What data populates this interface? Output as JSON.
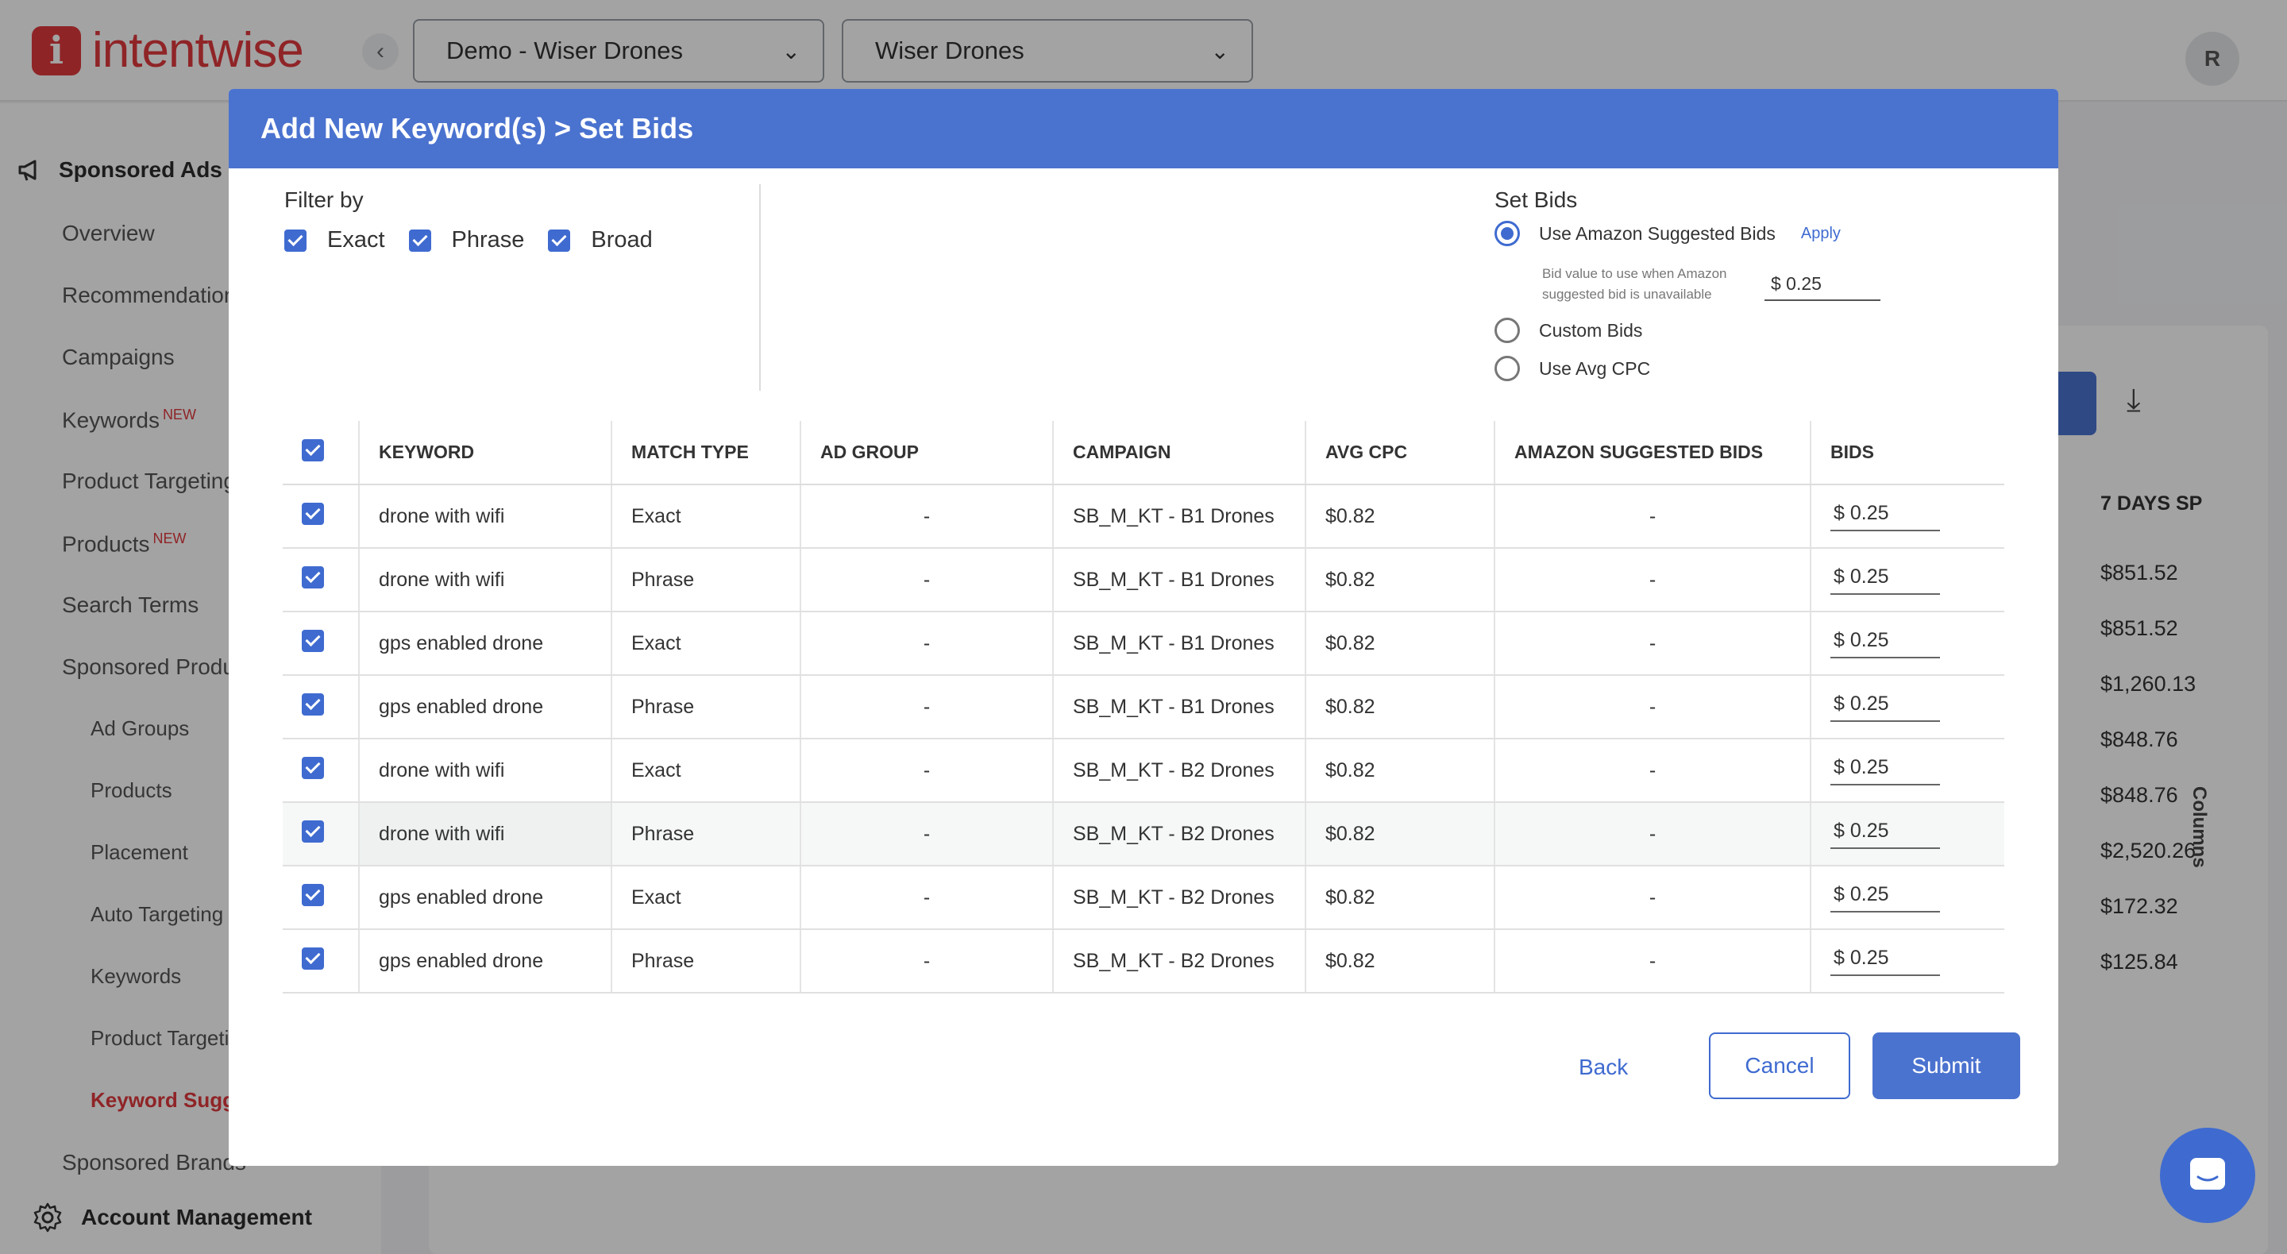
{
  "app": {
    "logo_text": "intentwise",
    "logo_mark": "i",
    "account_select": "Demo - Wiser Drones",
    "profile_select": "Wiser Drones",
    "avatar_initial": "R"
  },
  "sidebar": {
    "section": "Sponsored Ads",
    "items": [
      {
        "label": "Overview",
        "badge": ""
      },
      {
        "label": "Recommendations",
        "badge": ""
      },
      {
        "label": "Campaigns",
        "badge": ""
      },
      {
        "label": "Keywords",
        "badge": "NEW"
      },
      {
        "label": "Product Targeting",
        "badge": ""
      },
      {
        "label": "Products",
        "badge": "NEW"
      },
      {
        "label": "Search Terms",
        "badge": ""
      },
      {
        "label": "Sponsored Products",
        "badge": ""
      }
    ],
    "sub_items": [
      "Ad Groups",
      "Products",
      "Placement",
      "Auto Targeting",
      "Keywords",
      "Product Targeting",
      "Keyword Suggestions"
    ],
    "brands": "Sponsored Brands",
    "account_management": "Account Management"
  },
  "background_table": {
    "column_header": "7 DAYS SP",
    "values": [
      "$851.52",
      "$851.52",
      "$1,260.13",
      "$848.76",
      "$848.76",
      "$2,520.26",
      "$172.32",
      "$125.84"
    ],
    "columns_label": "Columns"
  },
  "modal": {
    "title": "Add New Keyword(s) > Set Bids",
    "filter": {
      "title": "Filter by",
      "options": [
        "Exact",
        "Phrase",
        "Broad"
      ]
    },
    "set_bids": {
      "title": "Set Bids",
      "option_suggested": "Use Amazon Suggested Bids",
      "apply": "Apply",
      "fallback_note": "Bid value to use when Amazon suggested bid is unavailable",
      "fallback_value": "$  0.25",
      "option_custom": "Custom Bids",
      "option_avg_cpc": "Use Avg CPC"
    },
    "table": {
      "headers": [
        "KEYWORD",
        "MATCH TYPE",
        "AD GROUP",
        "CAMPAIGN",
        "AVG CPC",
        "AMAZON SUGGESTED BIDS",
        "BIDS"
      ],
      "rows": [
        {
          "keyword": "drone with wifi",
          "match": "Exact",
          "ad_group": "-",
          "campaign": "SB_M_KT - B1 Drones",
          "avg_cpc": "$0.82",
          "suggested": "-",
          "bid": "$ 0.25"
        },
        {
          "keyword": "drone with wifi",
          "match": "Phrase",
          "ad_group": "-",
          "campaign": "SB_M_KT - B1 Drones",
          "avg_cpc": "$0.82",
          "suggested": "-",
          "bid": "$ 0.25"
        },
        {
          "keyword": "gps enabled drone",
          "match": "Exact",
          "ad_group": "-",
          "campaign": "SB_M_KT - B1 Drones",
          "avg_cpc": "$0.82",
          "suggested": "-",
          "bid": "$ 0.25"
        },
        {
          "keyword": "gps enabled drone",
          "match": "Phrase",
          "ad_group": "-",
          "campaign": "SB_M_KT - B1 Drones",
          "avg_cpc": "$0.82",
          "suggested": "-",
          "bid": "$ 0.25"
        },
        {
          "keyword": "drone with wifi",
          "match": "Exact",
          "ad_group": "-",
          "campaign": "SB_M_KT - B2 Drones",
          "avg_cpc": "$0.82",
          "suggested": "-",
          "bid": "$ 0.25"
        },
        {
          "keyword": "drone with wifi",
          "match": "Phrase",
          "ad_group": "-",
          "campaign": "SB_M_KT - B2 Drones",
          "avg_cpc": "$0.82",
          "suggested": "-",
          "bid": "$ 0.25"
        },
        {
          "keyword": "gps enabled drone",
          "match": "Exact",
          "ad_group": "-",
          "campaign": "SB_M_KT - B2 Drones",
          "avg_cpc": "$0.82",
          "suggested": "-",
          "bid": "$ 0.25"
        },
        {
          "keyword": "gps enabled drone",
          "match": "Phrase",
          "ad_group": "-",
          "campaign": "SB_M_KT - B2 Drones",
          "avg_cpc": "$0.82",
          "suggested": "-",
          "bid": "$ 0.25"
        }
      ]
    },
    "buttons": {
      "back": "Back",
      "cancel": "Cancel",
      "submit": "Submit"
    }
  },
  "colors": {
    "brand": "#e0393e",
    "accent": "#4a72cf"
  }
}
